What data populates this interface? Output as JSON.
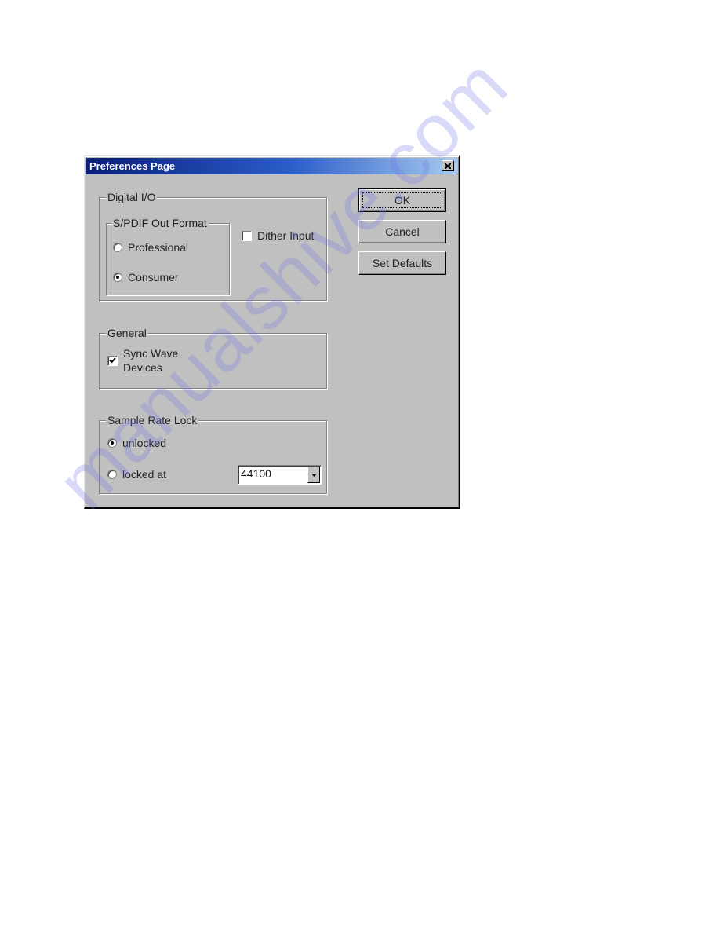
{
  "dialog": {
    "title": "Preferences Page",
    "close_icon": "close-x-icon"
  },
  "digital_io": {
    "legend": "Digital I/O",
    "spdif": {
      "legend": "S/PDIF Out Format",
      "options": [
        {
          "label": "Professional",
          "checked": false
        },
        {
          "label": "Consumer",
          "checked": true
        }
      ]
    },
    "dither_input": {
      "label": "Dither Input",
      "checked": false
    }
  },
  "general": {
    "legend": "General",
    "sync_wave": {
      "label_line1": "Sync Wave",
      "label_line2": "Devices",
      "checked": true
    }
  },
  "sample_rate_lock": {
    "legend": "Sample Rate Lock",
    "options": [
      {
        "label": "unlocked",
        "checked": true
      },
      {
        "label": "locked at",
        "checked": false
      }
    ],
    "rate_select": {
      "value": "44100",
      "icon": "dropdown-arrow-icon"
    }
  },
  "buttons": {
    "ok": "OK",
    "cancel": "Cancel",
    "set_defaults": "Set Defaults"
  },
  "watermark": "manualshive.com"
}
